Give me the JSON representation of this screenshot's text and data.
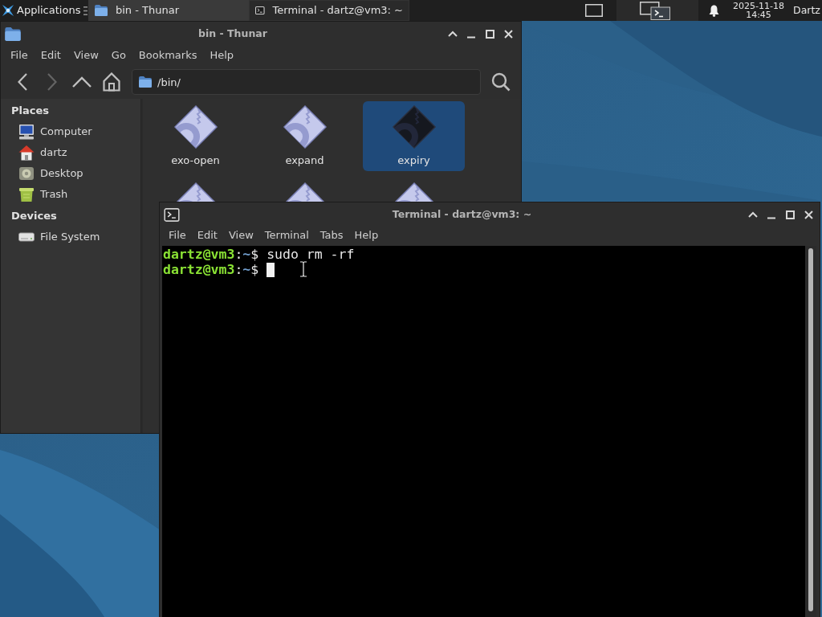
{
  "panel": {
    "menu_label": "Applications",
    "tasks": [
      {
        "label": "bin - Thunar",
        "kind": "folder",
        "selected": false
      },
      {
        "label": "Terminal - dartz@vm3: ~",
        "kind": "terminal",
        "selected": true
      }
    ],
    "clock": {
      "date": "2025-11-18",
      "time": "14:45"
    },
    "user": "Dartz"
  },
  "thunar": {
    "title": "bin - Thunar",
    "menu": [
      "File",
      "Edit",
      "View",
      "Go",
      "Bookmarks",
      "Help"
    ],
    "nav": [
      {
        "kind": "back",
        "disabled": false
      },
      {
        "kind": "forward",
        "disabled": true
      },
      {
        "kind": "up",
        "disabled": false
      },
      {
        "kind": "home",
        "disabled": false
      }
    ],
    "location": "/bin/",
    "sidebar": [
      {
        "title": "Places",
        "items": [
          {
            "label": "Computer",
            "kind": "computer",
            "selected": false
          },
          {
            "label": "dartz",
            "kind": "home",
            "selected": false
          },
          {
            "label": "Desktop",
            "kind": "desktop",
            "selected": false
          },
          {
            "label": "Trash",
            "kind": "trash",
            "selected": false
          }
        ]
      },
      {
        "title": "Devices",
        "items": [
          {
            "label": "File System",
            "kind": "drive",
            "selected": false
          }
        ]
      }
    ],
    "files": [
      {
        "name": "exo-open",
        "selected": false
      },
      {
        "name": "expand",
        "selected": false
      },
      {
        "name": "expiry",
        "selected": true
      },
      {
        "selected": false
      },
      {
        "selected": false
      },
      {
        "selected": false
      }
    ]
  },
  "terminal": {
    "title": "Terminal - dartz@vm3: ~",
    "menu": [
      "File",
      "Edit",
      "View",
      "Terminal",
      "Tabs",
      "Help"
    ],
    "lines": [
      {
        "user": "dartz@vm3",
        "separator": ":",
        "path": "~",
        "prompt": "$",
        "command": "sudo rm -rf",
        "cursor": false
      },
      {
        "user": "dartz@vm3",
        "separator": ":",
        "path": "~",
        "prompt": "$",
        "cursor": true
      }
    ]
  }
}
